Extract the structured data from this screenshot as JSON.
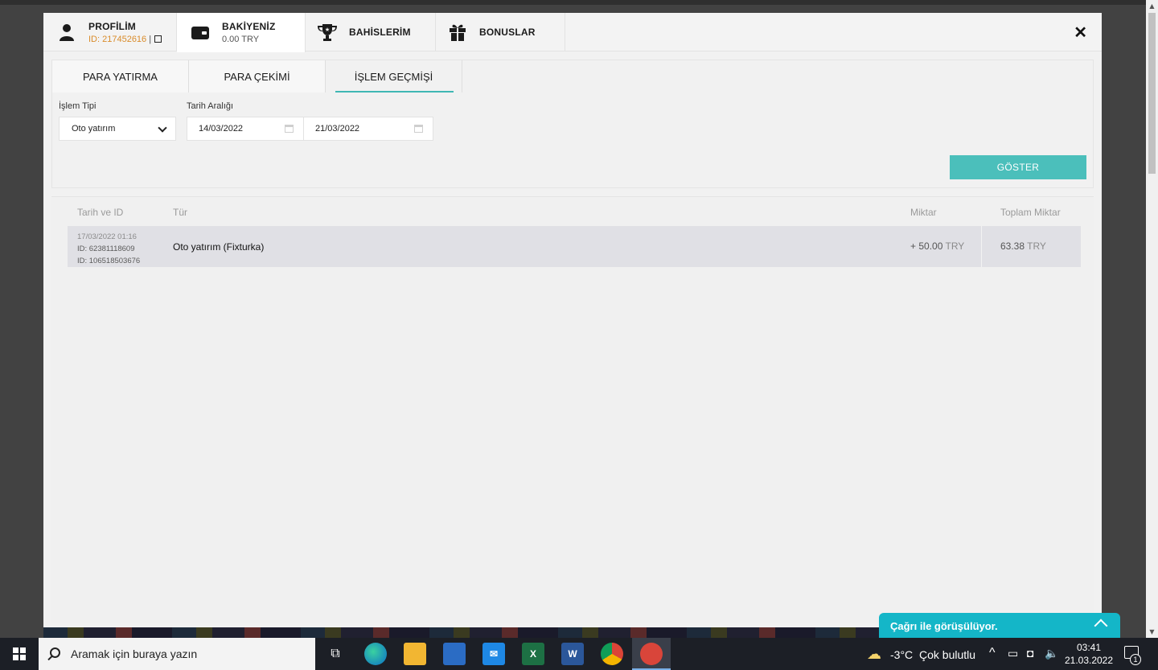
{
  "top_nav": {
    "profile": {
      "title": "PROFİLİM",
      "id_label": "ID: 217452616",
      "separator": "|"
    },
    "balance": {
      "title": "BAKİYENİZ",
      "value": "0.00 TRY"
    },
    "bets": {
      "title": "BAHİSLERİM"
    },
    "bonuses": {
      "title": "BONUSLAR"
    },
    "close": "✕"
  },
  "sub_tabs": [
    {
      "label": "PARA YATIRMA",
      "active": false
    },
    {
      "label": "PARA ÇEKİMİ",
      "active": false
    },
    {
      "label": "İŞLEM GEÇMİŞİ",
      "active": true
    }
  ],
  "filters": {
    "type_label": "İşlem Tipi",
    "type_value": "Oto yatırım",
    "date_label": "Tarih Aralığı",
    "date_from": "14/03/2022",
    "date_to": "21/03/2022",
    "show_button": "GÖSTER"
  },
  "table": {
    "headers": {
      "date_id": "Tarih ve ID",
      "type": "Tür",
      "amount": "Miktar",
      "total": "Toplam Miktar"
    },
    "rows": [
      {
        "datetime": "17/03/2022 01:16",
        "id1": "ID: 62381118609",
        "id2": "ID: 106518503676",
        "type": "Oto yatırım (Fixturka)",
        "amount": "+ 50.00",
        "amount_currency": "TRY",
        "total": "63.38",
        "total_currency": "TRY"
      }
    ]
  },
  "chat": {
    "label": "Çağrı ile görüşülüyor."
  },
  "taskbar": {
    "search_placeholder": "Aramak için buraya yazın",
    "weather_temp": "-3°C",
    "weather_desc": "Çok bulutlu",
    "time": "03:41",
    "date": "21.03.2022",
    "notification_count": "1"
  },
  "colors": {
    "accent": "#4bbfbb",
    "chat": "#14b6c8",
    "orange": "#d98c2b"
  }
}
